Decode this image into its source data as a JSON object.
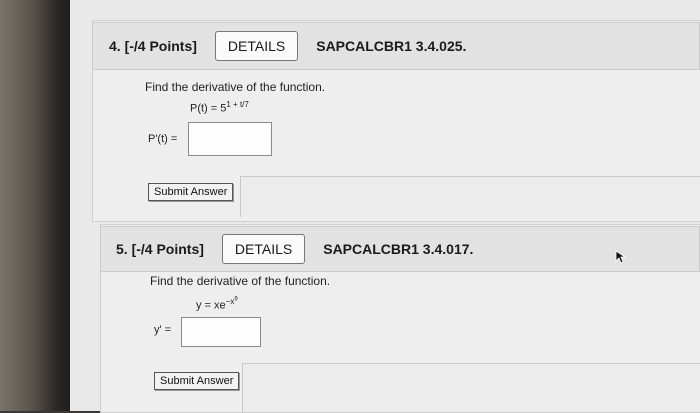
{
  "questions": [
    {
      "number": "4.",
      "points": "[-/4 Points]",
      "details_label": "DETAILS",
      "code": "SAPCALCBR1 3.4.025.",
      "prompt": "Find the derivative of the function.",
      "equation_lhs": "P(t) = 5",
      "equation_exponent": "1 + t/7",
      "answer_label": "P'(t) =",
      "answer_value": "",
      "submit_label": "Submit Answer"
    },
    {
      "number": "5.",
      "points": "[-/4 Points]",
      "details_label": "DETAILS",
      "code": "SAPCALCBR1 3.4.017.",
      "prompt": "Find the derivative of the function.",
      "equation_lhs": "y = xe",
      "equation_exponent": "−x",
      "equation_exponent_power": "9",
      "answer_label": "y' =",
      "answer_value": "",
      "submit_label": "Submit Answer"
    }
  ]
}
